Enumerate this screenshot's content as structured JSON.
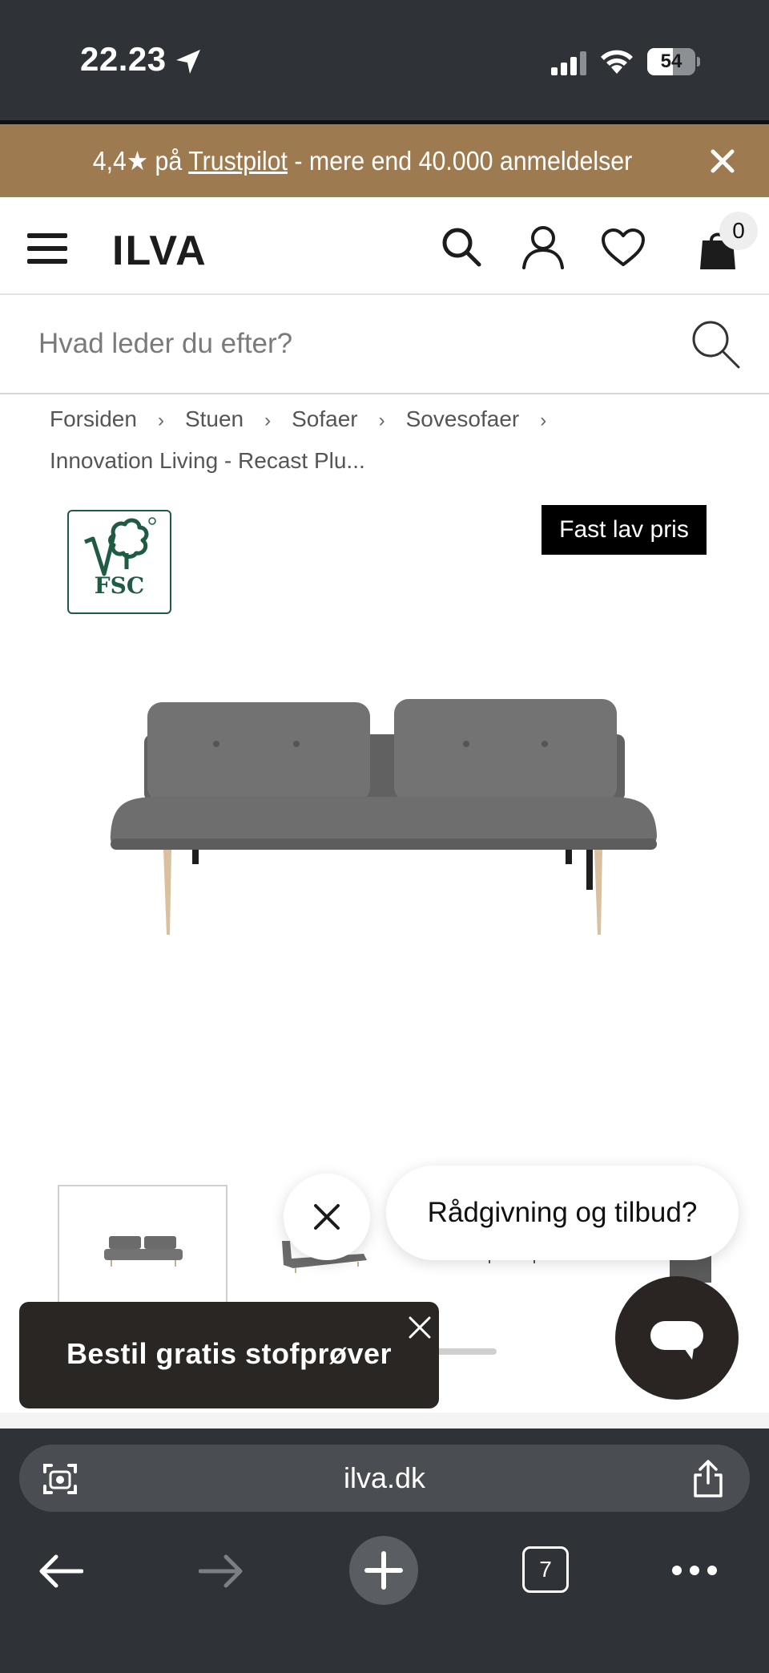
{
  "status_bar": {
    "time": "22.23",
    "battery_level": "54",
    "battery_fraction": 0.54
  },
  "promo_banner": {
    "rating_prefix": "4,4★ på ",
    "trustpilot_link": "Trustpilot",
    "rating_suffix": " - mere end 40.000 anmeldelser"
  },
  "header": {
    "logo_text": "ILVA",
    "cart_count": "0"
  },
  "search": {
    "placeholder": "Hvad leder du efter?"
  },
  "breadcrumb": {
    "items": [
      "Forsiden",
      "Stuen",
      "Sofaer",
      "Sovesofaer",
      "Innovation Living - Recast Plu..."
    ],
    "separator": "›"
  },
  "product": {
    "certification": "FSC",
    "price_badge": "Fast lav pris"
  },
  "chat": {
    "prompt": "Rådgivning og tilbud?"
  },
  "samples_toast": {
    "label": "Bestil gratis stofprøver"
  },
  "browser": {
    "url": "ilva.dk",
    "tab_count": "7"
  },
  "colors": {
    "promo_bar": "#9d7a50",
    "chrome": "#2f3236",
    "fsc_green": "#1f5a43",
    "sofa_fabric": "#6e6e6e"
  }
}
